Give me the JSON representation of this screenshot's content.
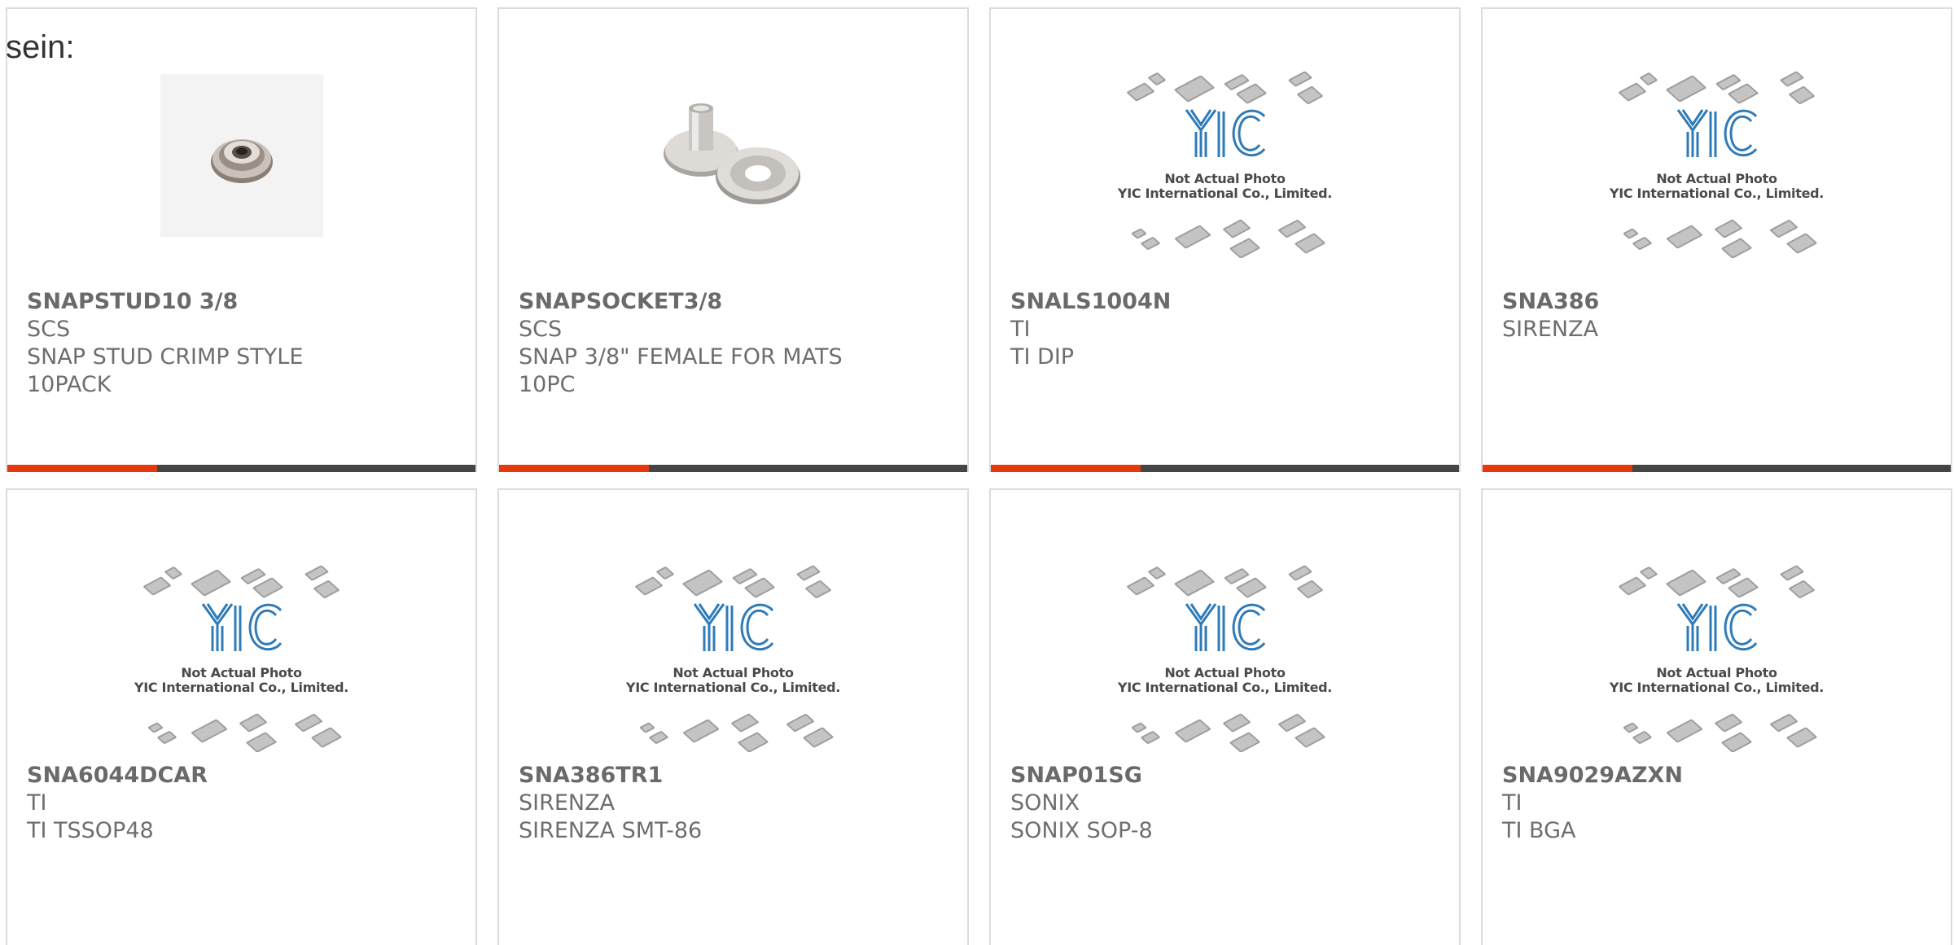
{
  "lead_text": "sein:",
  "colors": {
    "progress_fill": "#e5380c",
    "progress_track": "#454545",
    "card_border": "#dcdcdc",
    "text": "#6e6e6e"
  },
  "placeholder_image": {
    "line1": "Not Actual Photo",
    "line2": "YIC International Co., Limited."
  },
  "products": [
    {
      "part_number": "SNAPSTUD10 3/8",
      "manufacturer": "SCS",
      "description": "SNAP STUD CRIMP STYLE",
      "extra": "10PACK",
      "image": "snap-stud-photo",
      "progress": 0.32
    },
    {
      "part_number": "SNAPSOCKET3/8",
      "manufacturer": "SCS",
      "description": "SNAP 3/8\" FEMALE FOR MATS",
      "extra": "10PC",
      "image": "snap-socket-photo",
      "progress": 0.32
    },
    {
      "part_number": "SNALS1004N",
      "manufacturer": "TI",
      "description": "TI DIP",
      "extra": "",
      "image": "yic-placeholder",
      "progress": 0.32
    },
    {
      "part_number": "SNA386",
      "manufacturer": "SIRENZA",
      "description": "",
      "extra": "",
      "image": "yic-placeholder",
      "progress": 0.32
    },
    {
      "part_number": "SNA6044DCAR",
      "manufacturer": "TI",
      "description": "TI TSSOP48",
      "extra": "",
      "image": "yic-placeholder"
    },
    {
      "part_number": "SNA386TR1",
      "manufacturer": "SIRENZA",
      "description": "SIRENZA SMT-86",
      "extra": "",
      "image": "yic-placeholder"
    },
    {
      "part_number": "SNAP01SG",
      "manufacturer": "SONIX",
      "description": "SONIX SOP-8",
      "extra": "",
      "image": "yic-placeholder"
    },
    {
      "part_number": "SNA9029AZXN",
      "manufacturer": "TI",
      "description": "TI BGA",
      "extra": "",
      "image": "yic-placeholder"
    }
  ]
}
